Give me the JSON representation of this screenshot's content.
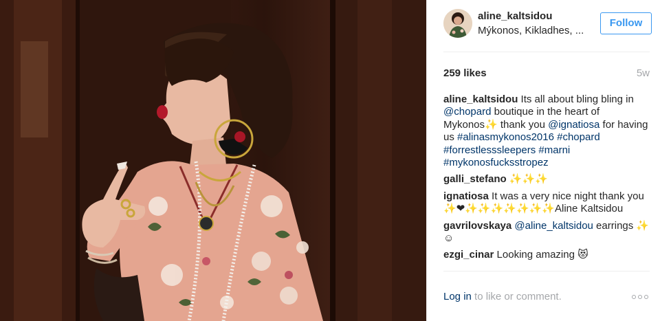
{
  "post": {
    "username": "aline_kaltsidou",
    "location": "Mýkonos, Kikladhes, ...",
    "follow_label": "Follow",
    "likes": "259 likes",
    "age": "5w",
    "photo_alt": "Woman in a floral pink pajama shirt with statement earring and pearl necklaces"
  },
  "comments": [
    {
      "user": "aline_kaltsidou",
      "parts": [
        {
          "t": " Its all about bling bling in ",
          "link": false
        },
        {
          "t": "@chopard",
          "link": true
        },
        {
          "t": " boutique in the heart of Mykonos✨ thank you ",
          "link": false
        },
        {
          "t": "@ignatiosa",
          "link": true
        },
        {
          "t": " for having us ",
          "link": false
        },
        {
          "t": "#alinasmykonos2016",
          "link": true
        },
        {
          "t": " ",
          "link": false
        },
        {
          "t": "#chopard",
          "link": true
        },
        {
          "t": " ",
          "link": false
        },
        {
          "t": "#forrestlesssleepers",
          "link": true
        },
        {
          "t": " ",
          "link": false
        },
        {
          "t": "#marni",
          "link": true
        },
        {
          "t": " ",
          "link": false
        },
        {
          "t": "#mykonosfucksstropez",
          "link": true
        }
      ]
    },
    {
      "user": "galli_stefano",
      "parts": [
        {
          "t": " ✨✨✨",
          "link": false
        }
      ]
    },
    {
      "user": "ignatiosa",
      "parts": [
        {
          "t": " It was a very nice night thank you ✨❤✨✨✨✨✨✨✨Aline Kaltsidou",
          "link": false
        }
      ]
    },
    {
      "user": "gavrilovskaya",
      "parts": [
        {
          "t": " ",
          "link": false
        },
        {
          "t": "@aline_kaltsidou",
          "link": true
        },
        {
          "t": " earrings ✨☺",
          "link": false
        }
      ]
    },
    {
      "user": "ezgi_cinar",
      "parts": [
        {
          "t": " Looking amazing 😻",
          "link": false
        }
      ]
    }
  ],
  "footer": {
    "login_link": "Log in",
    "login_rest": " to like or comment.",
    "more_icon": "more-options-icon"
  },
  "colors": {
    "link": "#003569",
    "follow": "#3897f0",
    "muted": "#a5a7aa",
    "divider": "#efefef"
  }
}
